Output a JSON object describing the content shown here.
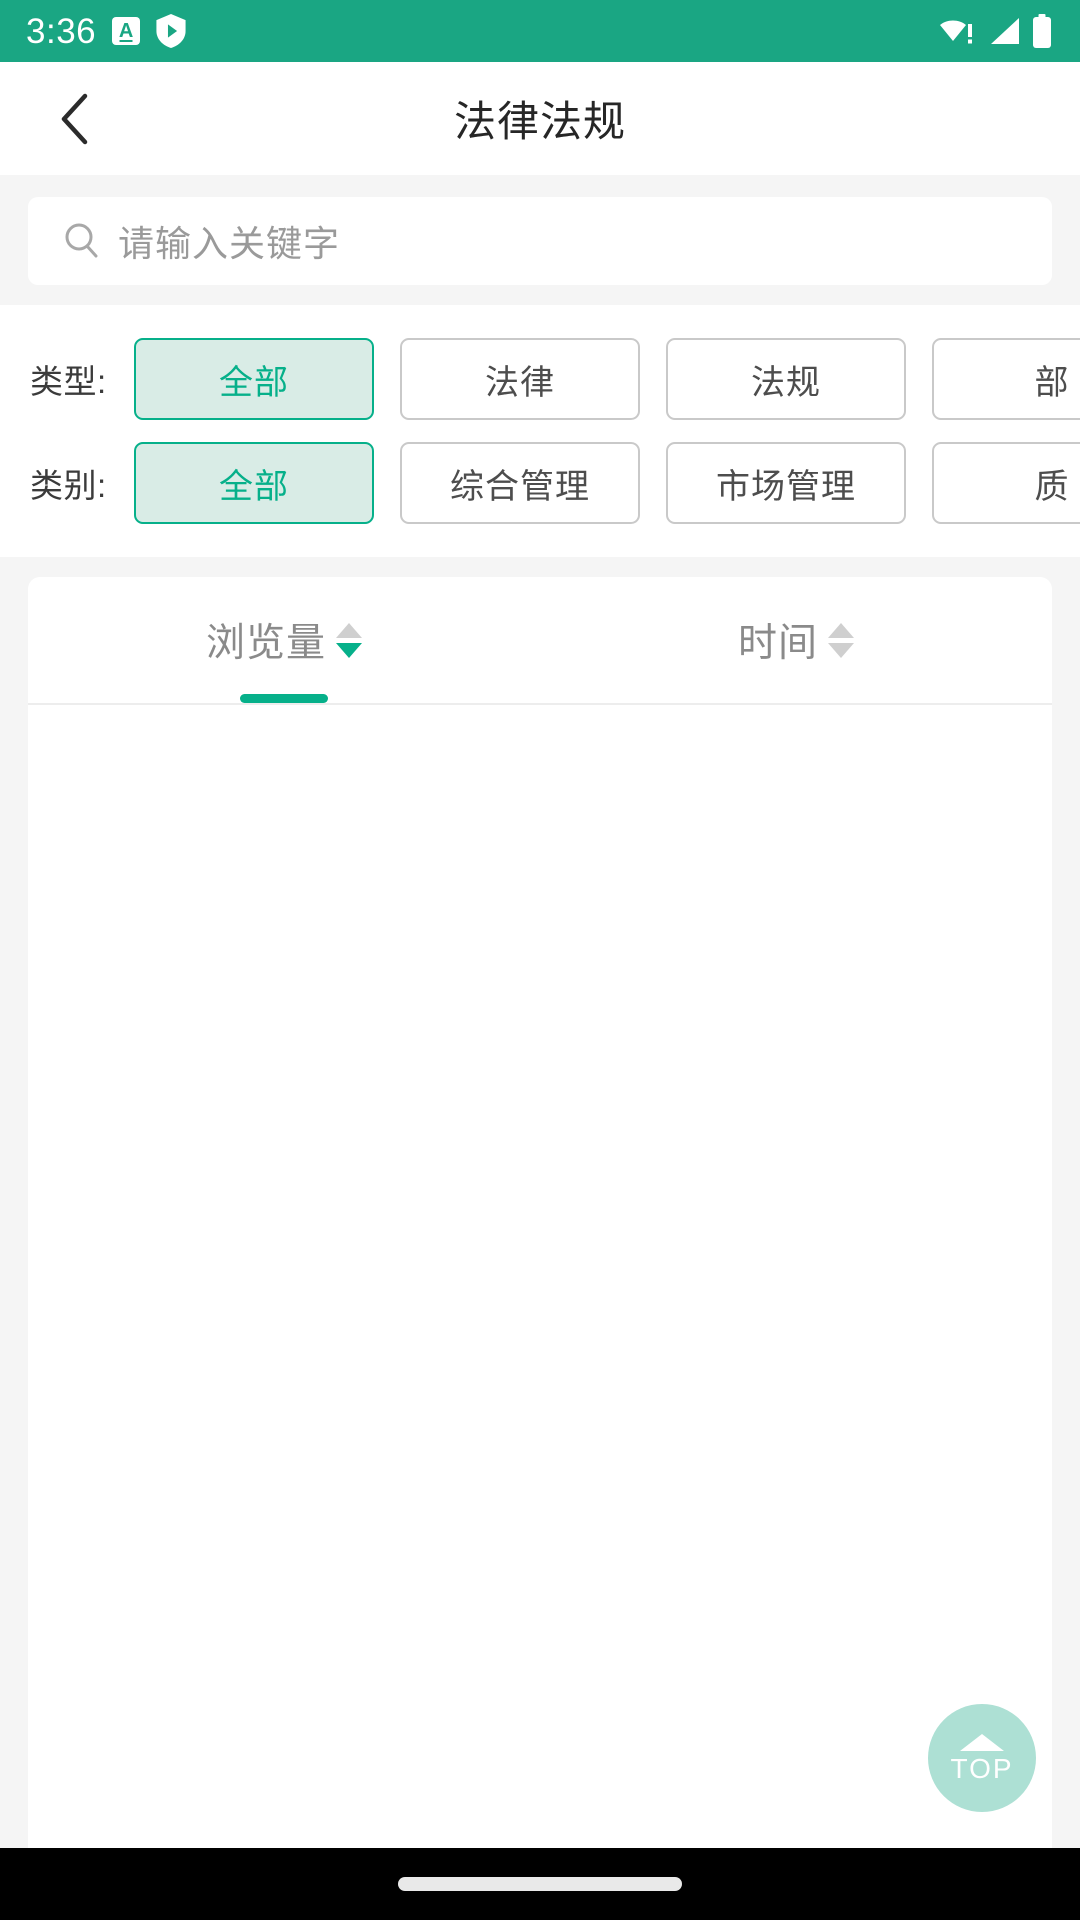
{
  "theme": {
    "brand": "#1aa683",
    "accent": "#06b08a",
    "chip_selected_bg": "#d9ece6",
    "page_bg": "#f5f5f5",
    "fab_bg": "#ade0d4",
    "muted_text": "#8a8a8a"
  },
  "status_bar": {
    "time": "3:36",
    "left_icons": [
      "a-badge-icon",
      "shield-play-icon"
    ],
    "right_icons": [
      "wifi-alert-icon",
      "cellular-signal-icon",
      "battery-full-icon"
    ]
  },
  "app_bar": {
    "title": "法律法规",
    "back_icon": "chevron-left-icon"
  },
  "search": {
    "icon": "search-icon",
    "value": "",
    "placeholder": "请输入关键字"
  },
  "filters": [
    {
      "key": "type",
      "label": "类型:",
      "chips": [
        {
          "label": "全部",
          "selected": true
        },
        {
          "label": "法律",
          "selected": false
        },
        {
          "label": "法规",
          "selected": false
        },
        {
          "label": "部",
          "selected": false
        }
      ]
    },
    {
      "key": "category",
      "label": "类别:",
      "chips": [
        {
          "label": "全部",
          "selected": true
        },
        {
          "label": "综合管理",
          "selected": false
        },
        {
          "label": "市场管理",
          "selected": false
        },
        {
          "label": "质",
          "selected": false
        }
      ]
    }
  ],
  "sort_tabs": [
    {
      "label": "浏览量",
      "active": true,
      "ascending_active": false,
      "descending_active": true
    },
    {
      "label": "时间",
      "active": false,
      "ascending_active": false,
      "descending_active": false
    }
  ],
  "list": {
    "items": [],
    "empty": true
  },
  "fab": {
    "icon": "arrow-up-icon",
    "label": "TOP"
  },
  "nav_bar": {
    "home_indicator": "home-indicator"
  }
}
